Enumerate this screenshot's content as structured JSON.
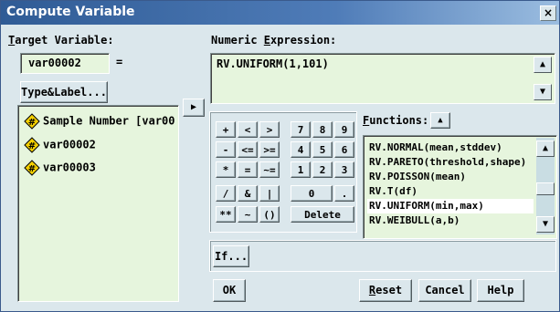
{
  "window": {
    "title": "Compute Variable",
    "close_label": "×"
  },
  "target": {
    "label": "Target Variable:",
    "value": "var00002",
    "equals": "=",
    "type_label_button": "Type&Label..."
  },
  "variables": [
    {
      "name": "Sample Number [var00",
      "icon": "numeric-variable-icon"
    },
    {
      "name": "var00002",
      "icon": "numeric-variable-icon"
    },
    {
      "name": "var00003",
      "icon": "numeric-variable-icon"
    }
  ],
  "move_arrow": "▶",
  "expression": {
    "label": "Numeric Expression:",
    "value": "RV.UNIFORM(1,101)"
  },
  "keypad": {
    "row1": [
      "+",
      "<",
      ">",
      "7",
      "8",
      "9"
    ],
    "row2": [
      "-",
      "<=",
      ">=",
      "4",
      "5",
      "6"
    ],
    "row3": [
      "*",
      "=",
      "~=",
      "1",
      "2",
      "3"
    ],
    "row4": [
      "/",
      "&",
      "|",
      "0",
      "."
    ],
    "row5": [
      "**",
      "~",
      "()",
      "Delete"
    ]
  },
  "functions": {
    "label": "Functions:",
    "items": [
      "RV.NORMAL(mean,stddev)",
      "RV.PARETO(threshold,shape)",
      "RV.POISSON(mean)",
      "RV.T(df)",
      "RV.UNIFORM(min,max)",
      "RV.WEIBULL(a,b)"
    ],
    "selected_index": 4
  },
  "if_button": "If...",
  "buttons": {
    "ok": "OK",
    "reset": "Reset",
    "cancel": "Cancel",
    "help": "Help"
  },
  "colors": {
    "dialog_bg": "#dbe7ec",
    "field_bg": "#e6f5dd",
    "title_start": "#2f5b95",
    "title_end": "#9bbde0"
  }
}
